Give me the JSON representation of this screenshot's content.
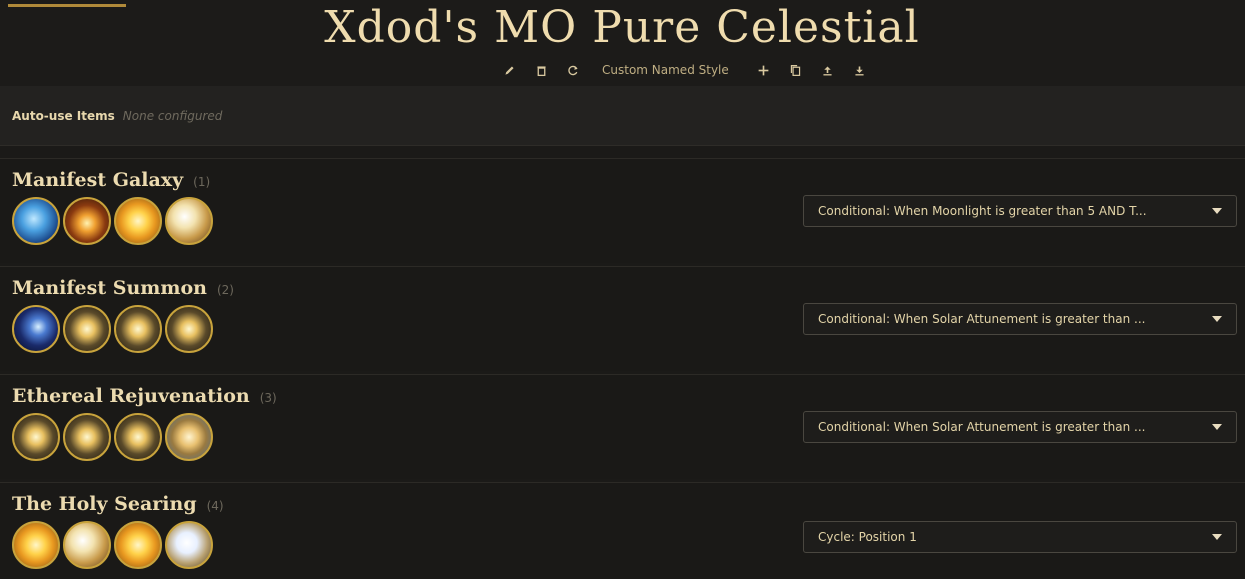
{
  "header": {
    "title": "Xdod's MO Pure Celestial",
    "toolbar": {
      "icons": [
        "pencil-icon",
        "trash-icon",
        "refresh-icon",
        "plus-icon",
        "copy-icon",
        "upload-icon",
        "download-icon"
      ],
      "style_name": "Custom Named Style"
    }
  },
  "auto_use": {
    "label": "Auto-use Items",
    "value": "None configured"
  },
  "sections": [
    {
      "name": "Manifest Galaxy",
      "number": "(1)",
      "icons": [
        "blue-swirl-icon",
        "explosion-icon",
        "sun-icon",
        "wing-icon"
      ],
      "condition": "Conditional: When Moonlight is greater than 5 AND T..."
    },
    {
      "name": "Manifest Summon",
      "number": "(2)",
      "icons": [
        "galaxy-icon",
        "starburst-icon",
        "starburst-icon",
        "starburst-icon"
      ],
      "condition": "Conditional: When Solar Attunement is greater than ..."
    },
    {
      "name": "Ethereal Rejuvenation",
      "number": "(3)",
      "icons": [
        "starburst-icon",
        "starburst-icon",
        "starburst-icon",
        "lion-emblem-icon"
      ],
      "condition": "Conditional: When Solar Attunement is greater than ..."
    },
    {
      "name": "The Holy Searing",
      "number": "(4)",
      "icons": [
        "sun-icon",
        "wing-icon",
        "sun-icon",
        "feather-icon"
      ],
      "condition": "Cycle: Position 1"
    }
  ],
  "colors": {
    "background": "#1b1a18",
    "title": "#efdcae",
    "accent_gold": "#c8a33c",
    "muted_text": "#6f6a5e"
  }
}
